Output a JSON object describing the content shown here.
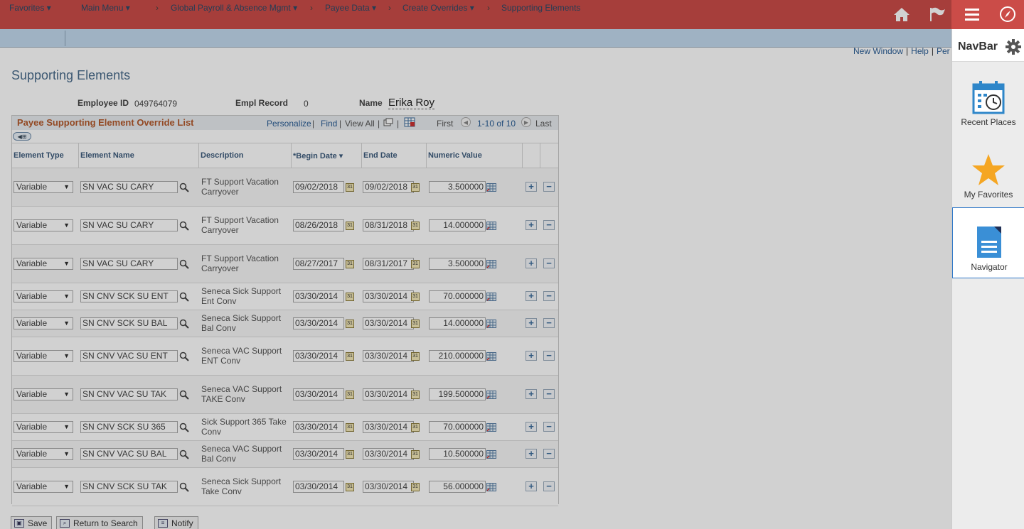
{
  "topbar": {
    "icons": [
      "home-icon",
      "flag-icon",
      "hamburger-menu-icon",
      "compass-icon"
    ]
  },
  "breadcrumb": {
    "items": [
      "Favorites",
      "Main Menu",
      "Global Payroll & Absence Mgmt",
      "Payee Data",
      "Create Overrides",
      "Supporting Elements"
    ]
  },
  "toplinks": {
    "new_window": "New Window",
    "help": "Help",
    "per": "Per"
  },
  "page": {
    "title": "Supporting Elements"
  },
  "employee": {
    "employee_id_label": "Employee ID",
    "employee_id": "049764079",
    "empl_record_label": "Empl Record",
    "empl_record": "0",
    "name_label": "Name",
    "name": "Erika Roy"
  },
  "grid": {
    "title": "Payee Supporting Element Override List",
    "personalize": "Personalize",
    "find": "Find",
    "view_all": "View All",
    "first": "First",
    "range": "1-10 of 10",
    "last": "Last",
    "columns": [
      "Element Type",
      "Element Name",
      "Description",
      "*Begin Date",
      "End Date",
      "Numeric Value"
    ],
    "rows": [
      {
        "type": "Variable",
        "name": "SN VAC SU CARY",
        "desc": "FT Support Vacation Carryover",
        "begin": "09/02/2018",
        "end": "09/02/2018",
        "value": "3.500000"
      },
      {
        "type": "Variable",
        "name": "SN VAC SU CARY",
        "desc": "FT Support Vacation Carryover",
        "begin": "08/26/2018",
        "end": "08/31/2018",
        "value": "14.000000"
      },
      {
        "type": "Variable",
        "name": "SN VAC SU CARY",
        "desc": "FT Support Vacation Carryover",
        "begin": "08/27/2017",
        "end": "08/31/2017",
        "value": "3.500000"
      },
      {
        "type": "Variable",
        "name": "SN CNV SCK SU ENT",
        "desc": "Seneca Sick Support Ent Conv",
        "begin": "03/30/2014",
        "end": "03/30/2014",
        "value": "70.000000"
      },
      {
        "type": "Variable",
        "name": "SN CNV SCK SU BAL",
        "desc": "Seneca Sick Support Bal Conv",
        "begin": "03/30/2014",
        "end": "03/30/2014",
        "value": "14.000000"
      },
      {
        "type": "Variable",
        "name": "SN CNV VAC SU ENT",
        "desc": "Seneca VAC Support ENT Conv",
        "begin": "03/30/2014",
        "end": "03/30/2014",
        "value": "210.000000"
      },
      {
        "type": "Variable",
        "name": "SN CNV VAC SU TAK",
        "desc": "Seneca VAC Support TAKE Conv",
        "begin": "03/30/2014",
        "end": "03/30/2014",
        "value": "199.500000"
      },
      {
        "type": "Variable",
        "name": "SN CNV SCK SU 365",
        "desc": "Sick Support 365 Take Conv",
        "begin": "03/30/2014",
        "end": "03/30/2014",
        "value": "70.000000"
      },
      {
        "type": "Variable",
        "name": "SN CNV VAC SU BAL",
        "desc": "Seneca VAC Support Bal Conv",
        "begin": "03/30/2014",
        "end": "03/30/2014",
        "value": "10.500000"
      },
      {
        "type": "Variable",
        "name": "SN CNV SCK SU TAK",
        "desc": "Seneca Sick Support Take Conv",
        "begin": "03/30/2014",
        "end": "03/30/2014",
        "value": "56.000000"
      }
    ]
  },
  "buttons": {
    "save": "Save",
    "return": "Return to Search",
    "notify": "Notify"
  },
  "navbar": {
    "title": "NavBar",
    "tiles": [
      {
        "label": "Recent Places",
        "icon": "calendar-clock-icon"
      },
      {
        "label": "My Favorites",
        "icon": "star-icon"
      },
      {
        "label": "Navigator",
        "icon": "document-icon"
      }
    ]
  },
  "colors": {
    "topbar": "#cb4c48",
    "breadcrumb_bg": "#c2daee",
    "grid_title": "#b45a2c",
    "link": "#2a5d95",
    "favorites_star": "#f5a623",
    "navigator_blue": "#3a8fd6"
  }
}
